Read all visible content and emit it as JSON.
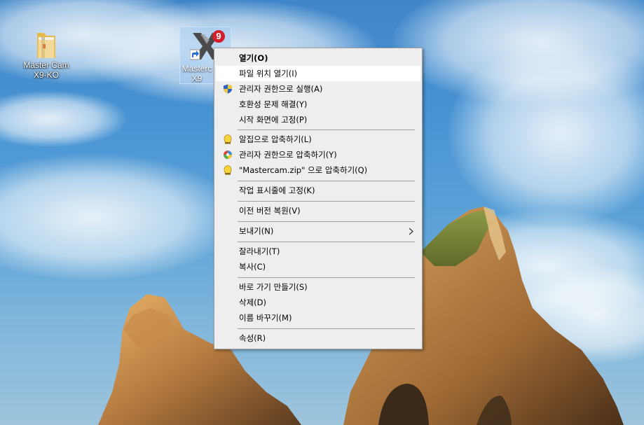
{
  "desktop": {
    "icons": [
      {
        "label_line1": "Master Cam",
        "label_line2": "X9-KO"
      },
      {
        "label_line1": "Masterc",
        "label_line2": "X9"
      }
    ]
  },
  "context_menu": {
    "items": [
      {
        "label": "열기(O)",
        "icon": ""
      },
      {
        "label": "파일 위치 열기(I)",
        "icon": ""
      },
      {
        "label": "관리자 권한으로 실행(A)",
        "icon": "uac-shield-icon"
      },
      {
        "label": "호환성 문제 해결(Y)",
        "icon": ""
      },
      {
        "label": "시작 화면에 고정(P)",
        "icon": ""
      },
      {
        "label": "알집으로 압축하기(L)",
        "icon": "alzip-icon"
      },
      {
        "label": "관리자 권한으로 압축하기(Y)",
        "icon": "alzip-admin-icon"
      },
      {
        "label": "\"Mastercam.zip\" 으로 압축하기(Q)",
        "icon": "alzip-icon"
      },
      {
        "label": "작업 표시줄에 고정(K)",
        "icon": ""
      },
      {
        "label": "이전 버전 복원(V)",
        "icon": ""
      },
      {
        "label": "보내기(N)",
        "icon": "submenu-chevron-icon"
      },
      {
        "label": "잘라내기(T)",
        "icon": ""
      },
      {
        "label": "복사(C)",
        "icon": ""
      },
      {
        "label": "바로 가기 만들기(S)",
        "icon": ""
      },
      {
        "label": "삭제(D)",
        "icon": ""
      },
      {
        "label": "이름 바꾸기(M)",
        "icon": ""
      },
      {
        "label": "속성(R)",
        "icon": ""
      }
    ]
  }
}
